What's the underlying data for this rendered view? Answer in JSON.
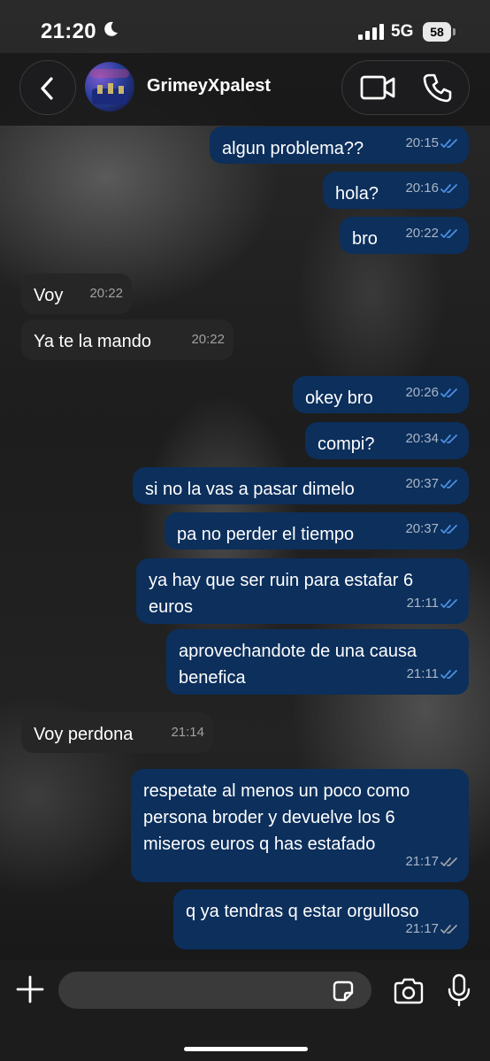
{
  "status_bar": {
    "time": "21:20",
    "network": "5G",
    "battery": "58"
  },
  "header": {
    "contact_name": "GrimeyXpalest"
  },
  "messages": [
    {
      "dir": "out",
      "lines": [
        "algun problema??"
      ],
      "time": "20:15"
    },
    {
      "dir": "out",
      "lines": [
        "hola?"
      ],
      "time": "20:16"
    },
    {
      "dir": "out",
      "lines": [
        "bro"
      ],
      "time": "20:22"
    },
    {
      "dir": "in",
      "lines": [
        "Voy"
      ],
      "time": "20:22"
    },
    {
      "dir": "in",
      "lines": [
        "Ya te la mando"
      ],
      "time": "20:22"
    },
    {
      "dir": "out",
      "lines": [
        "okey bro"
      ],
      "time": "20:26"
    },
    {
      "dir": "out",
      "lines": [
        "compi?"
      ],
      "time": "20:34"
    },
    {
      "dir": "out",
      "lines": [
        "si no la vas a pasar dimelo"
      ],
      "time": "20:37"
    },
    {
      "dir": "out",
      "lines": [
        "pa no perder el tiempo"
      ],
      "time": "20:37"
    },
    {
      "dir": "out",
      "lines": [
        "ya hay que ser ruin para estafar 6",
        "euros"
      ],
      "time": "21:11"
    },
    {
      "dir": "out",
      "lines": [
        "aprovechandote de una causa",
        "benefica"
      ],
      "time": "21:11"
    },
    {
      "dir": "in",
      "lines": [
        "Voy perdona"
      ],
      "time": "21:14"
    },
    {
      "dir": "out",
      "lines": [
        "respetate al menos un poco como",
        "persona broder y devuelve los 6",
        "miseros euros q has estafado"
      ],
      "time": "21:17"
    },
    {
      "dir": "out",
      "lines": [
        "q ya tendras q estar orgulloso"
      ],
      "time": "21:17"
    }
  ],
  "colors": {
    "outgoing_bubble": "#0c2f5c",
    "incoming_bubble": "#262626",
    "read_tick": "#4a90e2",
    "delivered_tick": "#9aa0a6"
  },
  "input": {
    "placeholder": ""
  }
}
